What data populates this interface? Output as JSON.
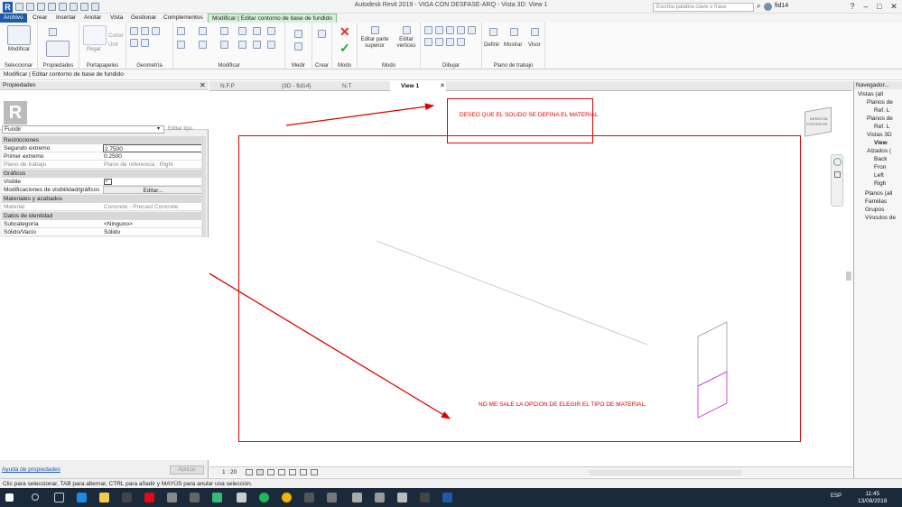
{
  "window": {
    "title": "Autodesk Revit 2019 - VIGA CON DESFASE-ARQ - Vista 3D: View 1",
    "search_placeholder": "Escriba palabra clave o frase",
    "user": "fid14"
  },
  "ribbon_tabs": [
    "Archivo",
    "Crear",
    "Insertar",
    "Anotar",
    "Vista",
    "Gestionar",
    "Complementos",
    "Modificar | Editar contorno de base de fundido"
  ],
  "ribbon": {
    "modificar": "Modificar",
    "pegar": "Pegar",
    "cortar": "Cortar",
    "unir": "Unir",
    "editar_superior": "Editar parte superior",
    "editar_vertices": "Editar vértices",
    "definir": "Definir",
    "mostrar": "Mostrar",
    "visor": "Visor",
    "panels": [
      "Seleccionar",
      "Propiedades",
      "Portapapeles",
      "Geometría",
      "Modificar",
      "Medir",
      "Crear",
      "Modo",
      "Modo",
      "Dibujar",
      "Plano de trabajo"
    ]
  },
  "options_bar": "Modificar | Editar contorno de base de fundido",
  "properties": {
    "title": "Propiedades",
    "type_selector": "Fundir",
    "edit_type": "Editar tipo",
    "categories": {
      "restricciones": "Restricciones",
      "graficos": "Gráficos",
      "materiales": "Materiales y acabados",
      "identidad": "Datos de identidad"
    },
    "rows": {
      "segundo_extremo": {
        "name": "Segundo extremo",
        "value": "2.7500"
      },
      "primer_extremo": {
        "name": "Primer extremo",
        "value": "0.2500"
      },
      "plano_trabajo": {
        "name": "Plano de trabajo",
        "value": "Plano de referencia : Right"
      },
      "visible": {
        "name": "Visible",
        "value": "✓"
      },
      "modif_visibilidad": {
        "name": "Modificaciones de visibilidad/gráficos",
        "value": "Editar..."
      },
      "material": {
        "name": "Material",
        "value": "Concrete - Precast Concrete"
      },
      "subcategoria": {
        "name": "Subcategoría",
        "value": "<Ninguno>"
      },
      "solido_vacio": {
        "name": "Sólido/Vacío",
        "value": "Sólido"
      }
    },
    "help_link": "Ayuda de propiedades",
    "apply": "Aplicar"
  },
  "view_tabs": [
    "N.F.P",
    "{3D - fid14}",
    "N.T",
    "View 1"
  ],
  "view_scale": "1 : 20",
  "view_cube": {
    "top": "DERECHA",
    "face": "POSTERIOR"
  },
  "annotations": {
    "note1": "DESEO QUE EL SOLIDO SE DEFINA EL MATERIAL",
    "note2": "NO ME SALE LA OPCION DE ELEGIR EL TIPO DE MATERIAL."
  },
  "navigator": {
    "title": "Navegador...",
    "items": [
      "Vistas (all",
      "Planos de",
      "Ref. L",
      "Planos de",
      "Ref. L",
      "Vistas 3D",
      "View",
      "Alzados (",
      "Back",
      "Fron",
      "Left",
      "Righ",
      "Planos (all",
      "Familias",
      "Grupos",
      "Vínculos de"
    ]
  },
  "status_bar": "Clic para seleccionar, TAB para alternar, CTRL para añadir y MAYÚS para anular una selección.",
  "taskbar": {
    "lang": "ESP",
    "time": "11:45",
    "date": "13/08/2018"
  },
  "colors": {
    "annotation_red": "#e00000",
    "ctx_tab": "#d6f0dc",
    "revit_blue": "#1f5aa8"
  }
}
